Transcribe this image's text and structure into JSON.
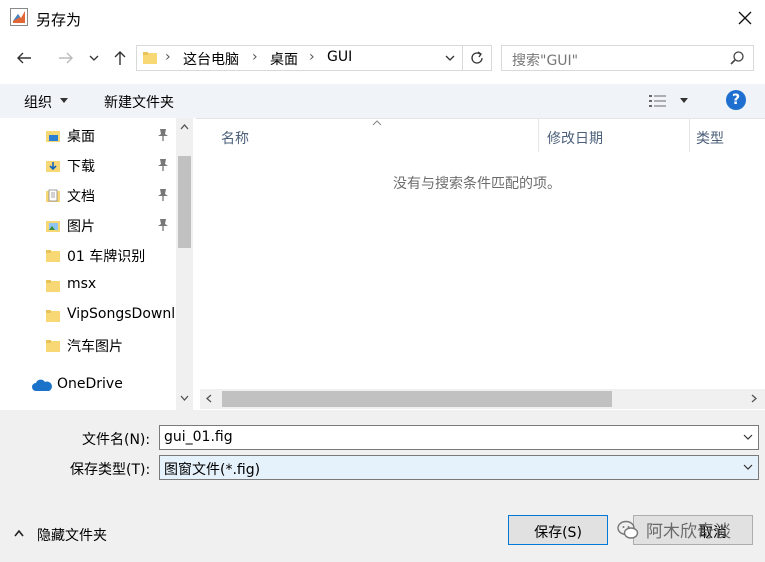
{
  "window": {
    "title": "另存为"
  },
  "nav": {
    "breadcrumb": [
      "这台电脑",
      "桌面",
      "GUI"
    ],
    "search_placeholder": "搜索\"GUI\""
  },
  "toolbar": {
    "organize_label": "组织",
    "new_folder_label": "新建文件夹"
  },
  "sidebar": {
    "items": [
      {
        "label": "桌面",
        "icon": "desktop-folder-icon",
        "pinned": true
      },
      {
        "label": "下载",
        "icon": "download-folder-icon",
        "pinned": true
      },
      {
        "label": "文档",
        "icon": "documents-folder-icon",
        "pinned": true
      },
      {
        "label": "图片",
        "icon": "pictures-folder-icon",
        "pinned": true
      },
      {
        "label": "01 车牌识别",
        "icon": "folder-icon",
        "pinned": false
      },
      {
        "label": "msx",
        "icon": "folder-icon",
        "pinned": false
      },
      {
        "label": "VipSongsDownload",
        "icon": "folder-icon",
        "pinned": false
      },
      {
        "label": "汽车图片",
        "icon": "folder-icon",
        "pinned": false
      },
      {
        "label": "OneDrive",
        "icon": "cloud-icon",
        "pinned": false
      }
    ]
  },
  "list": {
    "columns": [
      "名称",
      "修改日期",
      "类型"
    ],
    "empty_message": "没有与搜索条件匹配的项。"
  },
  "form": {
    "filename_label": "文件名(N):",
    "filename_value": "gui_01.fig",
    "filetype_label": "保存类型(T):",
    "filetype_value": "图窗文件(*.fig)"
  },
  "footer": {
    "hide_folders_label": "隐藏文件夹",
    "save_label": "保存(S)",
    "cancel_label": "取消"
  },
  "watermark": {
    "text": "阿木欣奇谈"
  },
  "colors": {
    "accent": "#0078d7",
    "folder": "#f8d775",
    "help": "#1e6fd0"
  }
}
